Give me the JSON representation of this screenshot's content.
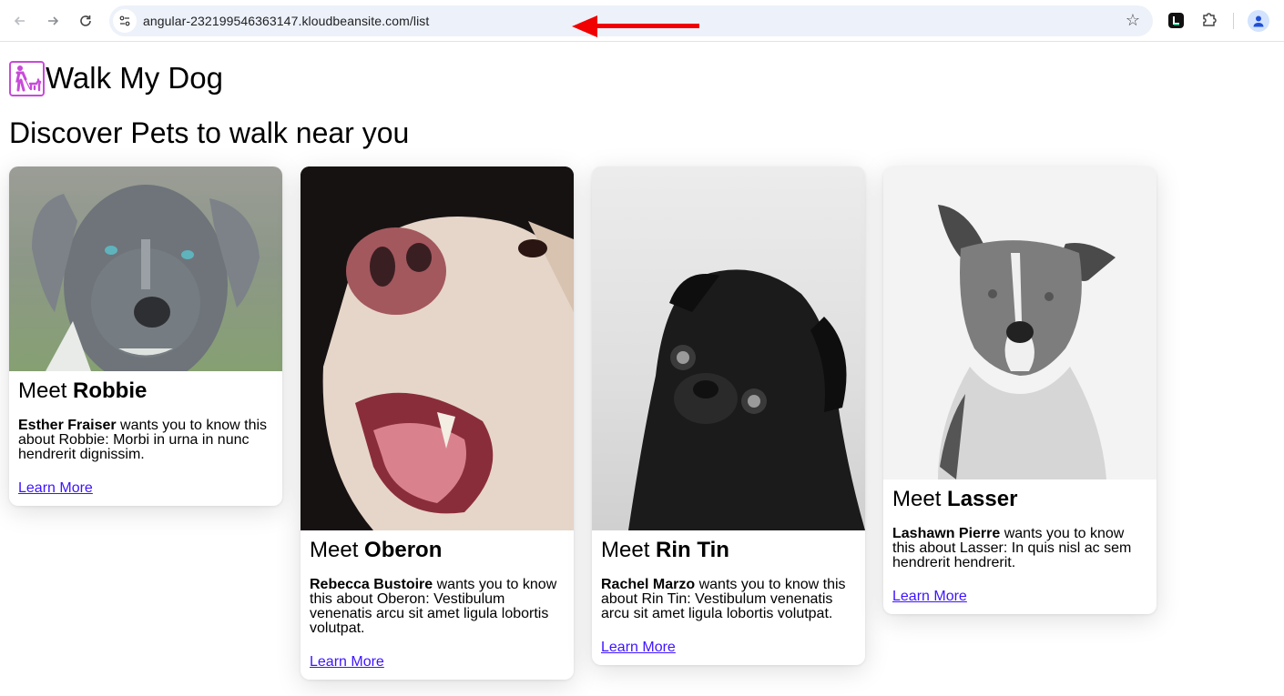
{
  "browser": {
    "url": "angular-232199546363147.kloudbeansite.com/list",
    "annotation": "red-arrow-pointing-to-url",
    "icons": [
      "back-icon",
      "forward-icon",
      "reload-icon",
      "site-info-icon",
      "bookmark-star-icon",
      "extension-l-icon",
      "extensions-puzzle-icon",
      "profile-icon"
    ]
  },
  "header": {
    "logo_icon": "person-walking-dog-icon",
    "title": "Walk My Dog"
  },
  "page": {
    "subtitle": "Discover Pets to walk near you"
  },
  "pets": [
    {
      "meet_prefix": "Meet",
      "name": "Robbie",
      "owner": "Esther Fraiser",
      "desc": " wants you to know this about Robbie: Morbi in urna in nunc hendrerit dignissim.",
      "link": "Learn More",
      "photo": "grey pit bull puppy with blue eyes on green background"
    },
    {
      "meet_prefix": "Meet",
      "name": "Oberon",
      "owner": "Rebecca Bustoire",
      "desc": " wants you to know this about Oberon: Vestibulum venenatis arcu sit amet ligula lobortis volutpat.",
      "link": "Learn More",
      "photo": "close-up of cream golden retriever with open mouth on dark background"
    },
    {
      "meet_prefix": "Meet",
      "name": "Rin Tin",
      "owner": "Rachel Marzo",
      "desc": " wants you to know this about Rin Tin: Vestibulum venenatis arcu sit amet ligula lobortis volutpat.",
      "link": "Learn More",
      "photo": "black and white photo of black pug tilting head"
    },
    {
      "meet_prefix": "Meet",
      "name": "Lasser",
      "owner": "Lashawn Pierre",
      "desc": " wants you to know this about Lasser: In quis nisl ac sem hendrerit hendrerit.",
      "link": "Learn More",
      "photo": "black and white photo of short-haired dog with pointed ears"
    }
  ]
}
